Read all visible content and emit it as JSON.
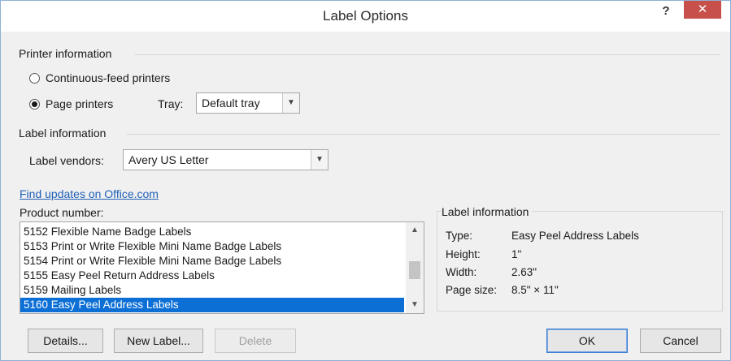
{
  "window": {
    "title": "Label Options",
    "help": "?",
    "close": "✕"
  },
  "printer_info": {
    "title": "Printer information",
    "continuous": "Continuous-feed printers",
    "page": "Page printers",
    "selected": "page",
    "tray_label": "Tray:",
    "tray_value": "Default tray"
  },
  "label_info_group": {
    "title": "Label information",
    "vendors_label": "Label vendors:",
    "vendors_value": "Avery US Letter"
  },
  "link": {
    "text": "Find updates on Office.com"
  },
  "product": {
    "label": "Product number:",
    "items": [
      "5152 Flexible Name Badge Labels",
      "5153 Print or Write Flexible Mini Name Badge Labels",
      "5154 Print or Write Flexible Mini Name Badge Labels",
      "5155 Easy Peel Return Address Labels",
      "5159 Mailing Labels",
      "5160 Easy Peel Address Labels"
    ],
    "selected_index": 5
  },
  "details_panel": {
    "title": "Label information",
    "type_label": "Type:",
    "type_value": "Easy Peel Address Labels",
    "height_label": "Height:",
    "height_value": "1\"",
    "width_label": "Width:",
    "width_value": "2.63\"",
    "page_size_label": "Page size:",
    "page_size_value": "8.5\" × 11\""
  },
  "buttons": {
    "details": "Details...",
    "new_label": "New Label...",
    "delete": "Delete",
    "ok": "OK",
    "cancel": "Cancel"
  },
  "colors": {
    "accent": "#0c6fd6",
    "close": "#c7504b",
    "link": "#1f5fb8"
  },
  "icons": {
    "help": "help-icon",
    "close": "close-icon",
    "dropdown": "chevron-down-icon"
  }
}
